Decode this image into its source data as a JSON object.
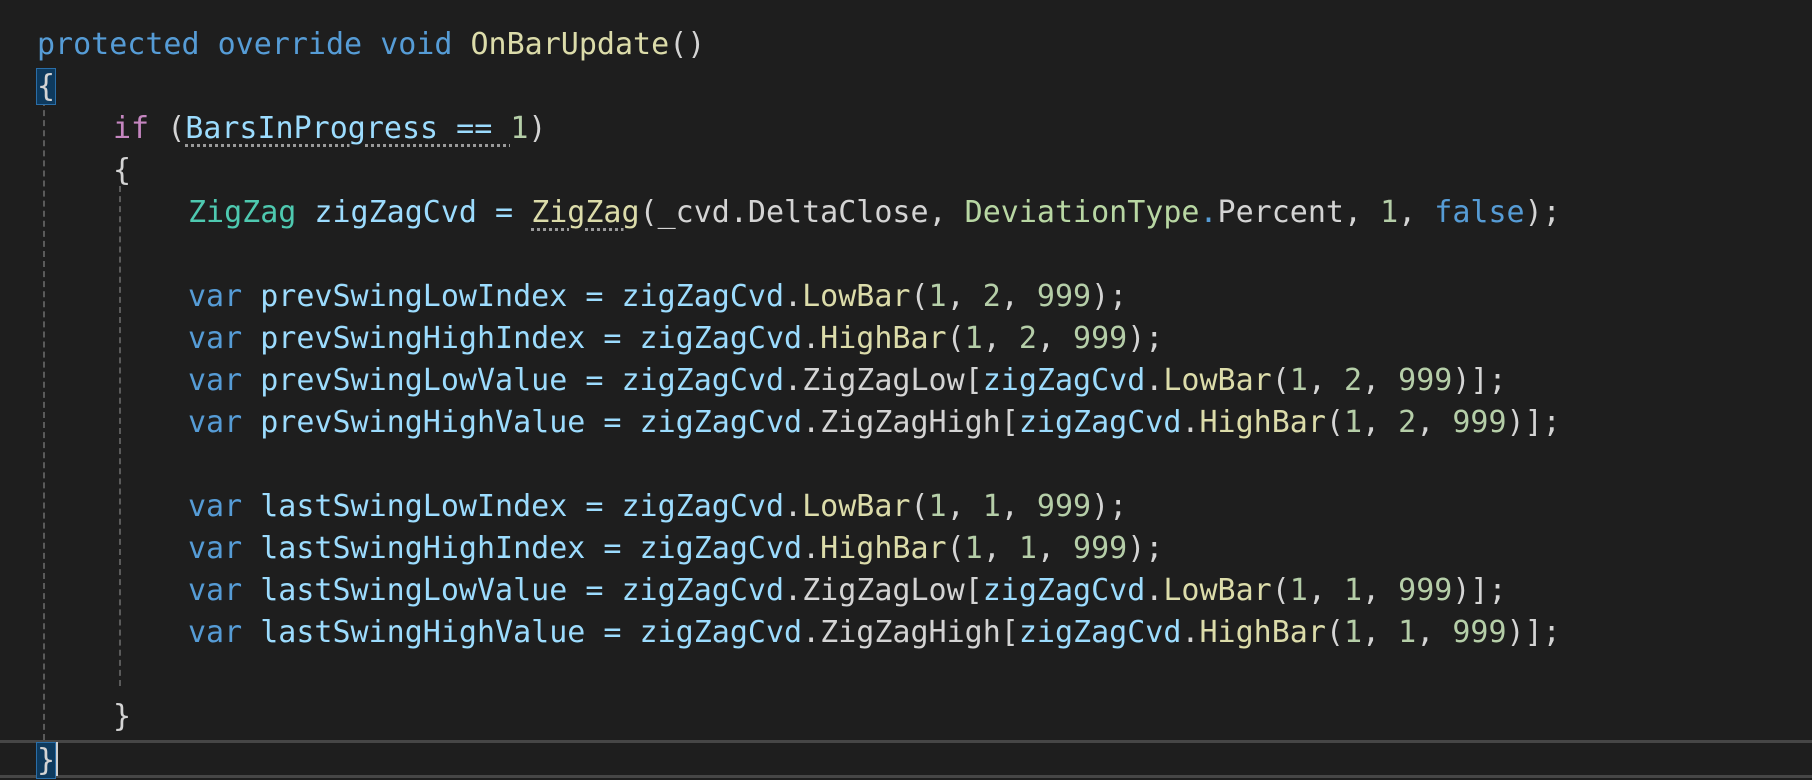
{
  "editor": {
    "signature": {
      "modifier1": "protected",
      "modifier2": "override",
      "return_type": "void",
      "method_name": "OnBarUpdate",
      "params": "()"
    },
    "method_open_brace": "{",
    "if_line": {
      "keyword": "if",
      "open": "(",
      "condition": "BarsInProgress == ",
      "value": "1",
      "close": ")"
    },
    "if_open_brace": "{",
    "zigzag_line": {
      "type": "ZigZag",
      "name": " zigZagCvd = ",
      "call": "ZigZag",
      "arg1": "(_cvd.DeltaClose, ",
      "enum_type": "DeviationType",
      "enum_dot": ".",
      "enum_member": "Percent, ",
      "num": "1",
      "sep": ", ",
      "bool": "false",
      "end": ");"
    },
    "prev_lines": [
      {
        "kw": "var",
        "name": " prevSwingLowIndex = ",
        "obj": "zigZagCvd",
        "dot": ".",
        "method": "LowBar",
        "args_open": "(",
        "a1": "1",
        "s1": ", ",
        "a2": "2",
        "s2": ", ",
        "a3": "999",
        "end": ");"
      },
      {
        "kw": "var",
        "name": " prevSwingHighIndex = ",
        "obj": "zigZagCvd",
        "dot": ".",
        "method": "HighBar",
        "args_open": "(",
        "a1": "1",
        "s1": ", ",
        "a2": "2",
        "s2": ", ",
        "a3": "999",
        "end": ");"
      }
    ],
    "prev_value_lines": [
      {
        "kw": "var",
        "name": " prevSwingLowValue = ",
        "obj": "zigZagCvd",
        "prop": ".ZigZagLow[",
        "obj2": "zigZagCvd",
        "dot": ".",
        "method": "LowBar",
        "args_open": "(",
        "a1": "1",
        "s1": ", ",
        "a2": "2",
        "s2": ", ",
        "a3": "999",
        "end": ")];"
      },
      {
        "kw": "var",
        "name": " prevSwingHighValue = ",
        "obj": "zigZagCvd",
        "prop": ".ZigZagHigh[",
        "obj2": "zigZagCvd",
        "dot": ".",
        "method": "HighBar",
        "args_open": "(",
        "a1": "1",
        "s1": ", ",
        "a2": "2",
        "s2": ", ",
        "a3": "999",
        "end": ")];"
      }
    ],
    "last_lines": [
      {
        "kw": "var",
        "name": " lastSwingLowIndex = ",
        "obj": "zigZagCvd",
        "dot": ".",
        "method": "LowBar",
        "args_open": "(",
        "a1": "1",
        "s1": ", ",
        "a2": "1",
        "s2": ", ",
        "a3": "999",
        "end": ");"
      },
      {
        "kw": "var",
        "name": " lastSwingHighIndex = ",
        "obj": "zigZagCvd",
        "dot": ".",
        "method": "HighBar",
        "args_open": "(",
        "a1": "1",
        "s1": ", ",
        "a2": "1",
        "s2": ", ",
        "a3": "999",
        "end": ");"
      }
    ],
    "last_value_lines": [
      {
        "kw": "var",
        "name": " lastSwingLowValue = ",
        "obj": "zigZagCvd",
        "prop": ".ZigZagLow[",
        "obj2": "zigZagCvd",
        "dot": ".",
        "method": "LowBar",
        "args_open": "(",
        "a1": "1",
        "s1": ", ",
        "a2": "1",
        "s2": ", ",
        "a3": "999",
        "end": ")];"
      },
      {
        "kw": "var",
        "name": " lastSwingHighValue = ",
        "obj": "zigZagCvd",
        "prop": ".ZigZagHigh[",
        "obj2": "zigZagCvd",
        "dot": ".",
        "method": "HighBar",
        "args_open": "(",
        "a1": "1",
        "s1": ", ",
        "a2": "1",
        "s2": ", ",
        "a3": "999",
        "end": ")];"
      }
    ],
    "if_close_brace": "}",
    "method_close_brace": "}"
  }
}
